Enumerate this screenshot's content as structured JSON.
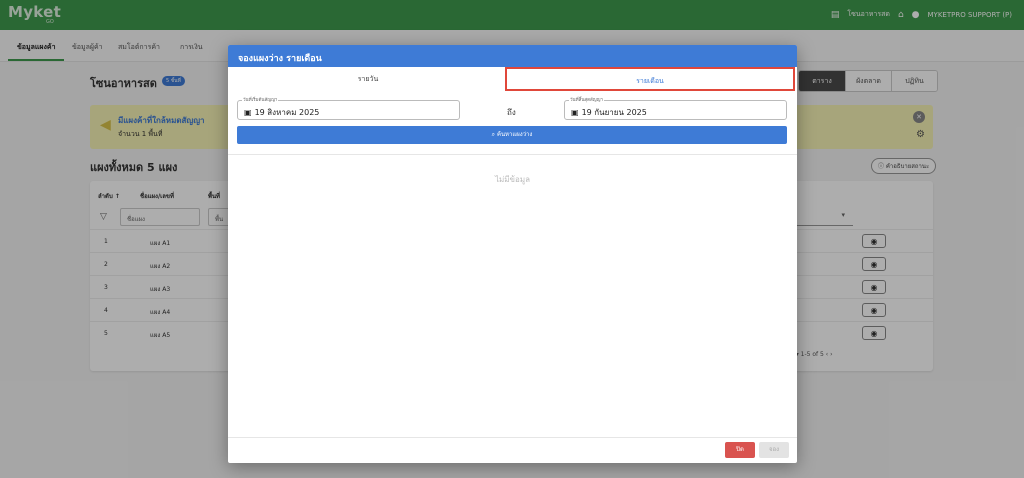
{
  "app": {
    "logo": "Myket",
    "logo_sub": "GO",
    "zone_link": "โซนอาหารสด",
    "user": "MYKETPRO SUPPORT (P)"
  },
  "nav": {
    "items": [
      "ข้อมูลแผงค้า",
      "ข้อมูลผู้ค้า",
      "สมโอต์การค้า",
      "การเงิน"
    ]
  },
  "page": {
    "zone_title": "โซนอาหารสด",
    "zone_badge": "5 ชั้นที่",
    "view_tabs": [
      "ตาราง",
      "ผังตลาด",
      "ปฏิทิน"
    ],
    "alert_title": "มีแผงค้าที่ใกล้หมดสัญญา",
    "alert_sub": "จำนวน 1 พื้นที่",
    "all_stalls": "แผงทั้งหมด 5 แผง",
    "legend_button": "คำอธิบายสถานะ",
    "table_headers": [
      "ลำดับ ↑",
      "ชื่อแผง/เลขที่",
      "พื้นที่"
    ],
    "filter_name_placeholder": "ชื่อแผง",
    "filter_area_placeholder": "พื้น",
    "rows": [
      {
        "num": "1",
        "name": "แผง A1"
      },
      {
        "num": "2",
        "name": "แผง A2"
      },
      {
        "num": "3",
        "name": "แผง A3"
      },
      {
        "num": "4",
        "name": "แผง A4"
      },
      {
        "num": "5",
        "name": "แผง A5"
      }
    ],
    "pagination": "5 ▾      1-5 of 5      ‹    ›"
  },
  "modal": {
    "title": "จองแผงว่าง รายเดือน",
    "tab_daily": "รายวัน",
    "tab_monthly": "รายเดือน",
    "start_label": "วันที่เริ่มต้นสัญญา",
    "start_value": "19 สิงหาคม 2025",
    "end_label": "วันที่สิ้นสุดสัญญา",
    "end_value": "19 กันยายน 2025",
    "to_label": "ถึง",
    "search_button": "ค้นหาแผงว่าง",
    "empty_text": "ไม่มีข้อมูล",
    "close_button": "ปิด",
    "book_button": "จอง"
  }
}
